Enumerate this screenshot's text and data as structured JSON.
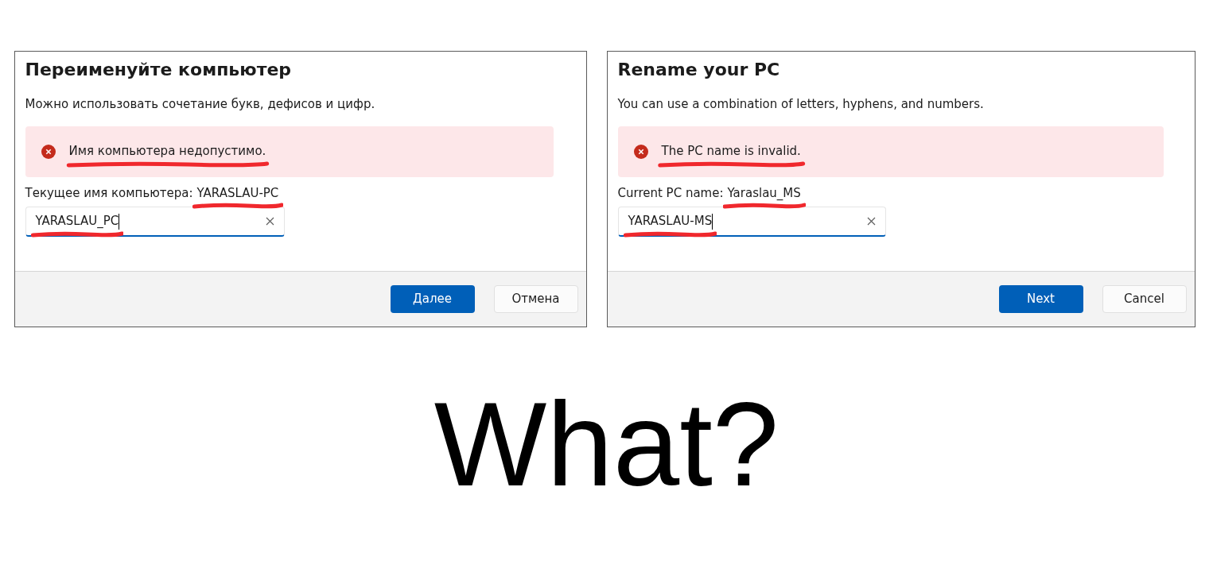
{
  "dialogs": [
    {
      "title": "Переименуйте компьютер",
      "description": "Можно использовать сочетание букв, дефисов и цифр.",
      "error": {
        "text": "Имя компьютера недопустимо.",
        "underlined": true
      },
      "current_name": {
        "label": "Текущее имя компьютера:",
        "value": "YARASLAU-PC",
        "underlined": true
      },
      "name_field": {
        "value": "YARASLAU_PC",
        "underlined": true
      },
      "buttons": [
        {
          "label": "Далее",
          "kind": "primary"
        },
        {
          "label": "Отмена",
          "kind": "secondary"
        }
      ]
    },
    {
      "title": "Rename your PC",
      "description": "You can use a combination of letters, hyphens, and numbers.",
      "error": {
        "text": "The PC name is invalid.",
        "underlined": true
      },
      "current_name": {
        "label": "Current PC name:",
        "value": "Yaraslau_MS",
        "underlined": true
      },
      "name_field": {
        "value": "YARASLAU-MS",
        "underlined": true
      },
      "buttons": [
        {
          "label": "Next",
          "kind": "primary"
        },
        {
          "label": "Cancel",
          "kind": "secondary"
        }
      ]
    }
  ],
  "caption": "What?"
}
